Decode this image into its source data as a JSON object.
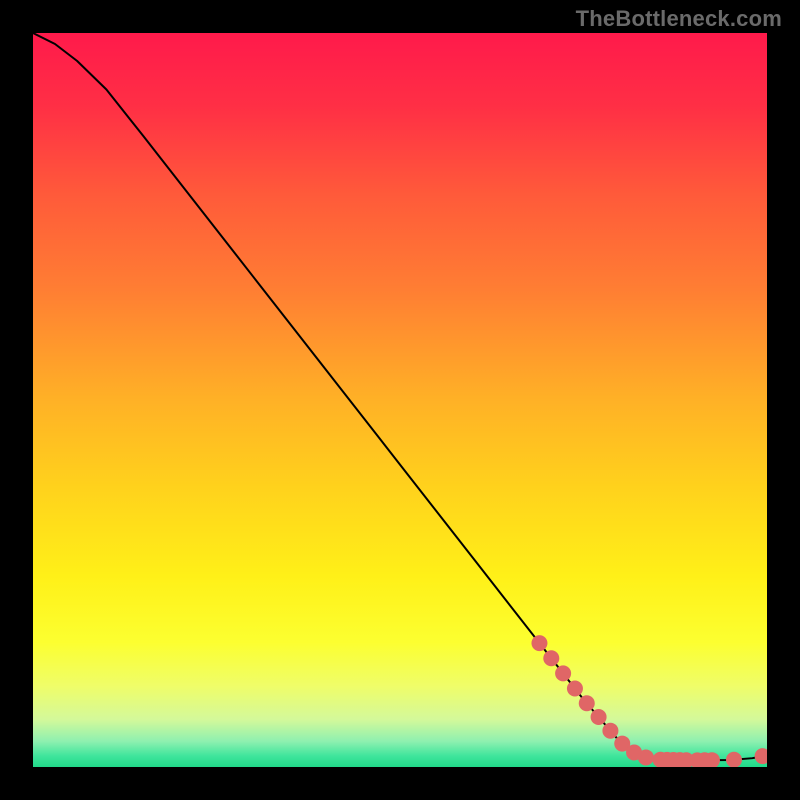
{
  "watermark": "TheBottleneck.com",
  "gradient": {
    "stops": [
      {
        "offset": 0.0,
        "color": "#ff1a4b"
      },
      {
        "offset": 0.1,
        "color": "#ff2f45"
      },
      {
        "offset": 0.22,
        "color": "#ff5a3a"
      },
      {
        "offset": 0.35,
        "color": "#ff7e33"
      },
      {
        "offset": 0.5,
        "color": "#ffb126"
      },
      {
        "offset": 0.62,
        "color": "#ffd21c"
      },
      {
        "offset": 0.74,
        "color": "#fff018"
      },
      {
        "offset": 0.83,
        "color": "#fcff30"
      },
      {
        "offset": 0.89,
        "color": "#effd69"
      },
      {
        "offset": 0.935,
        "color": "#d4f99a"
      },
      {
        "offset": 0.965,
        "color": "#8ef0b0"
      },
      {
        "offset": 0.985,
        "color": "#3fe59c"
      },
      {
        "offset": 1.0,
        "color": "#21d989"
      }
    ]
  },
  "chart_data": {
    "type": "line",
    "title": "",
    "xlabel": "",
    "ylabel": "",
    "xlim": [
      0,
      100
    ],
    "ylim": [
      0,
      100
    ],
    "curve": [
      {
        "x": 0,
        "y": 100
      },
      {
        "x": 3,
        "y": 98.5
      },
      {
        "x": 6,
        "y": 96.2
      },
      {
        "x": 10,
        "y": 92.3
      },
      {
        "x": 15,
        "y": 86.0
      },
      {
        "x": 20,
        "y": 79.6
      },
      {
        "x": 30,
        "y": 66.8
      },
      {
        "x": 40,
        "y": 54.0
      },
      {
        "x": 50,
        "y": 41.2
      },
      {
        "x": 60,
        "y": 28.4
      },
      {
        "x": 70,
        "y": 15.6
      },
      {
        "x": 75,
        "y": 9.2
      },
      {
        "x": 80,
        "y": 3.4
      },
      {
        "x": 82,
        "y": 1.9
      },
      {
        "x": 83.5,
        "y": 1.3
      },
      {
        "x": 85,
        "y": 1.0
      },
      {
        "x": 90,
        "y": 0.9
      },
      {
        "x": 95,
        "y": 0.95
      },
      {
        "x": 98,
        "y": 1.2
      },
      {
        "x": 100,
        "y": 1.6
      }
    ],
    "dot_segments": [
      {
        "xStart": 69,
        "xEnd": 83.5,
        "count": 10
      },
      {
        "xStart": 85.5,
        "xEnd": 89,
        "count": 5
      },
      {
        "xStart": 90.5,
        "xEnd": 92.5,
        "count": 3
      },
      {
        "xStart": 95.5,
        "xEnd": 95.5,
        "count": 1
      },
      {
        "xStart": 99.4,
        "xEnd": 99.4,
        "count": 1
      }
    ],
    "dot_color": "#e06666",
    "dot_radius": 8
  }
}
